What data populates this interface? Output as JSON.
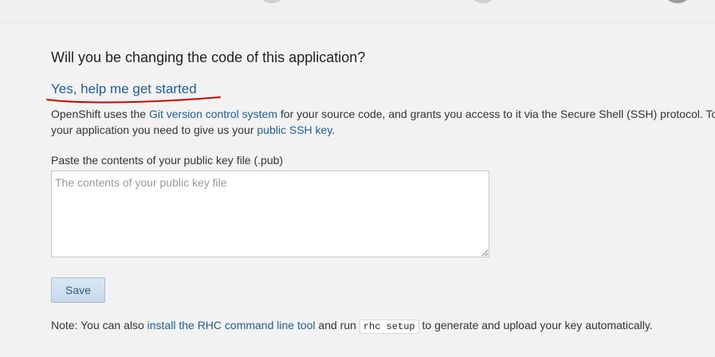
{
  "header": {
    "question": "Will you be changing the code of this application?"
  },
  "option": {
    "link_label": "Yes, help me get started"
  },
  "description": {
    "part1": "OpenShift uses the ",
    "git_link": "Git version control system",
    "part2": " for your source code, and grants you access to it via the Secure Shell (SSH) protocol. To upload code to",
    "line2_start": "your application you need to give us your ",
    "ssh_link": "public SSH key",
    "line2_end": "."
  },
  "key_form": {
    "label": "Paste the contents of your public key file (.pub)",
    "placeholder": "The contents of your public key file",
    "value": "",
    "save_label": "Save"
  },
  "note": {
    "prefix": "Note: You can also ",
    "rhc_link": "install the RHC command line tool",
    "middle": " and run ",
    "command": "rhc setup",
    "suffix": " to generate and upload your key automatically."
  },
  "colors": {
    "link": "#1f5e91",
    "annotation": "#d40000",
    "background": "#f2f2f2"
  }
}
